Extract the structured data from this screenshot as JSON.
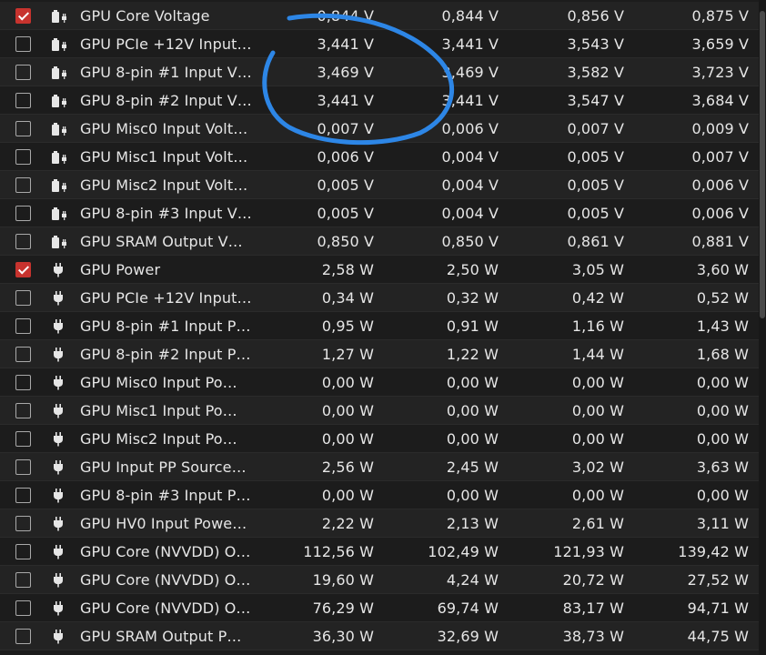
{
  "colors": {
    "checkbox_checked": "#c7332e",
    "annotation_circle": "#2d86e6",
    "row_odd": "#232323",
    "row_even": "#1c1c1c",
    "text": "#e6e6e6"
  },
  "sensor_table": {
    "rows": [
      {
        "checked": true,
        "icon": "battery-plug-icon",
        "name": "GPU Core Voltage",
        "current": "0,844 V",
        "min": "0,844 V",
        "avg": "0,856 V",
        "max": "0,875 V"
      },
      {
        "checked": false,
        "icon": "battery-plug-icon",
        "name": "GPU PCIe +12V Input…",
        "current": "3,441 V",
        "min": "3,441 V",
        "avg": "3,543 V",
        "max": "3,659 V"
      },
      {
        "checked": false,
        "icon": "battery-plug-icon",
        "name": "GPU 8-pin #1 Input V…",
        "current": "3,469 V",
        "min": "3,469 V",
        "avg": "3,582 V",
        "max": "3,723 V"
      },
      {
        "checked": false,
        "icon": "battery-plug-icon",
        "name": "GPU 8-pin #2 Input V…",
        "current": "3,441 V",
        "min": "3,441 V",
        "avg": "3,547 V",
        "max": "3,684 V"
      },
      {
        "checked": false,
        "icon": "battery-plug-icon",
        "name": "GPU Misc0 Input Volt…",
        "current": "0,007 V",
        "min": "0,006 V",
        "avg": "0,007 V",
        "max": "0,009 V"
      },
      {
        "checked": false,
        "icon": "battery-plug-icon",
        "name": "GPU Misc1 Input Volt…",
        "current": "0,006 V",
        "min": "0,004 V",
        "avg": "0,005 V",
        "max": "0,007 V"
      },
      {
        "checked": false,
        "icon": "battery-plug-icon",
        "name": "GPU Misc2 Input Volt…",
        "current": "0,005 V",
        "min": "0,004 V",
        "avg": "0,005 V",
        "max": "0,006 V"
      },
      {
        "checked": false,
        "icon": "battery-plug-icon",
        "name": "GPU 8-pin #3 Input V…",
        "current": "0,005 V",
        "min": "0,004 V",
        "avg": "0,005 V",
        "max": "0,006 V"
      },
      {
        "checked": false,
        "icon": "battery-plug-icon",
        "name": "GPU SRAM Output V…",
        "current": "0,850 V",
        "min": "0,850 V",
        "avg": "0,861 V",
        "max": "0,881 V"
      },
      {
        "checked": true,
        "icon": "power-plug-icon",
        "name": "GPU Power",
        "current": "2,58 W",
        "min": "2,50 W",
        "avg": "3,05 W",
        "max": "3,60 W"
      },
      {
        "checked": false,
        "icon": "power-plug-icon",
        "name": "GPU PCIe +12V Input…",
        "current": "0,34 W",
        "min": "0,32 W",
        "avg": "0,42 W",
        "max": "0,52 W"
      },
      {
        "checked": false,
        "icon": "power-plug-icon",
        "name": "GPU 8-pin #1 Input P…",
        "current": "0,95 W",
        "min": "0,91 W",
        "avg": "1,16 W",
        "max": "1,43 W"
      },
      {
        "checked": false,
        "icon": "power-plug-icon",
        "name": "GPU 8-pin #2 Input P…",
        "current": "1,27 W",
        "min": "1,22 W",
        "avg": "1,44 W",
        "max": "1,68 W"
      },
      {
        "checked": false,
        "icon": "power-plug-icon",
        "name": "GPU Misc0 Input Po…",
        "current": "0,00 W",
        "min": "0,00 W",
        "avg": "0,00 W",
        "max": "0,00 W"
      },
      {
        "checked": false,
        "icon": "power-plug-icon",
        "name": "GPU Misc1 Input Po…",
        "current": "0,00 W",
        "min": "0,00 W",
        "avg": "0,00 W",
        "max": "0,00 W"
      },
      {
        "checked": false,
        "icon": "power-plug-icon",
        "name": "GPU Misc2 Input Po…",
        "current": "0,00 W",
        "min": "0,00 W",
        "avg": "0,00 W",
        "max": "0,00 W"
      },
      {
        "checked": false,
        "icon": "power-plug-icon",
        "name": "GPU Input PP Source…",
        "current": "2,56 W",
        "min": "2,45 W",
        "avg": "3,02 W",
        "max": "3,63 W"
      },
      {
        "checked": false,
        "icon": "power-plug-icon",
        "name": "GPU 8-pin #3 Input P…",
        "current": "0,00 W",
        "min": "0,00 W",
        "avg": "0,00 W",
        "max": "0,00 W"
      },
      {
        "checked": false,
        "icon": "power-plug-icon",
        "name": "GPU HV0 Input Powe…",
        "current": "2,22 W",
        "min": "2,13 W",
        "avg": "2,61 W",
        "max": "3,11 W"
      },
      {
        "checked": false,
        "icon": "power-plug-icon",
        "name": "GPU Core (NVVDD) O…",
        "current": "112,56 W",
        "min": "102,49 W",
        "avg": "121,93 W",
        "max": "139,42 W"
      },
      {
        "checked": false,
        "icon": "power-plug-icon",
        "name": "GPU Core (NVVDD) O…",
        "current": "19,60 W",
        "min": "4,24 W",
        "avg": "20,72 W",
        "max": "27,52 W"
      },
      {
        "checked": false,
        "icon": "power-plug-icon",
        "name": "GPU Core (NVVDD) O…",
        "current": "76,29 W",
        "min": "69,74 W",
        "avg": "83,17 W",
        "max": "94,71 W"
      },
      {
        "checked": false,
        "icon": "power-plug-icon",
        "name": "GPU SRAM Output P…",
        "current": "36,30 W",
        "min": "32,69 W",
        "avg": "38,73 W",
        "max": "44,75 W"
      }
    ]
  }
}
